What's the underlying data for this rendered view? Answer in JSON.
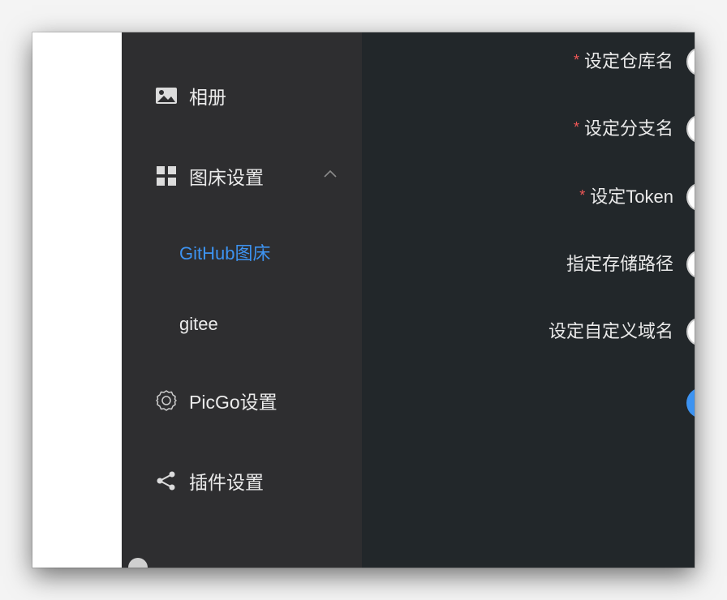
{
  "sidebar": {
    "items": [
      {
        "label": "相册",
        "icon": "image-icon"
      },
      {
        "label": "图床设置",
        "icon": "grid-icon",
        "expanded": true
      },
      {
        "label": "PicGo设置",
        "icon": "gear-icon"
      },
      {
        "label": "插件设置",
        "icon": "share-icon"
      }
    ],
    "submenu": [
      {
        "label": "GitHub图床",
        "active": true
      },
      {
        "label": "gitee",
        "active": false
      }
    ]
  },
  "form": {
    "fields": [
      {
        "label": "设定仓库名",
        "required": true,
        "required_mark": "*"
      },
      {
        "label": "设定分支名",
        "required": true,
        "required_mark": "*"
      },
      {
        "label": "设定Token",
        "required": true,
        "required_mark": "*"
      },
      {
        "label": "指定存储路径",
        "required": false
      },
      {
        "label": "设定自定义域名",
        "required": false
      }
    ]
  },
  "colors": {
    "accent": "#3d93f1",
    "required": "#f25757",
    "sidebar_bg": "#2e2e30",
    "main_bg": "#22272a",
    "text": "#eaeaea"
  }
}
